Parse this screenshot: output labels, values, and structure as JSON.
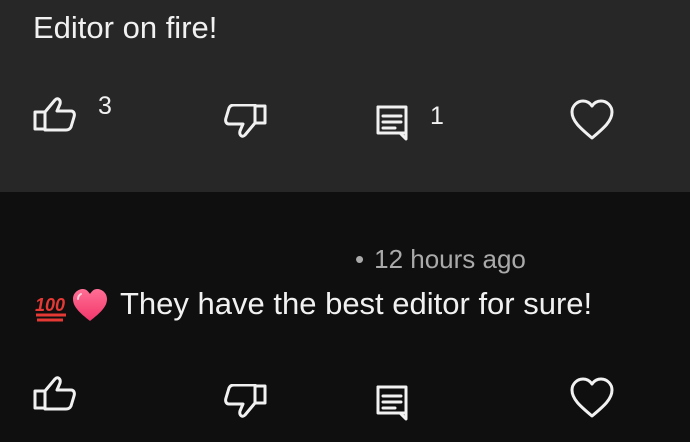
{
  "comments": [
    {
      "text": "Editor on fire!",
      "like_count": "3",
      "reply_count": "1",
      "icons": [
        "thumbs-up",
        "thumbs-down",
        "comment",
        "heart"
      ]
    },
    {
      "timestamp": "12 hours ago",
      "text": "They have the best editor for sure!",
      "emoji": [
        "100",
        "pink-heart"
      ],
      "icons": [
        "thumbs-up",
        "thumbs-down",
        "comment",
        "heart"
      ]
    }
  ],
  "colors": {
    "primary_bg": "#0f0f0f",
    "highlight_bg": "#272727",
    "text": "#f1f1f1",
    "meta_text": "#aaaaaa",
    "emoji_red": "#e53935",
    "emoji_pink": "#ff4f7d"
  }
}
